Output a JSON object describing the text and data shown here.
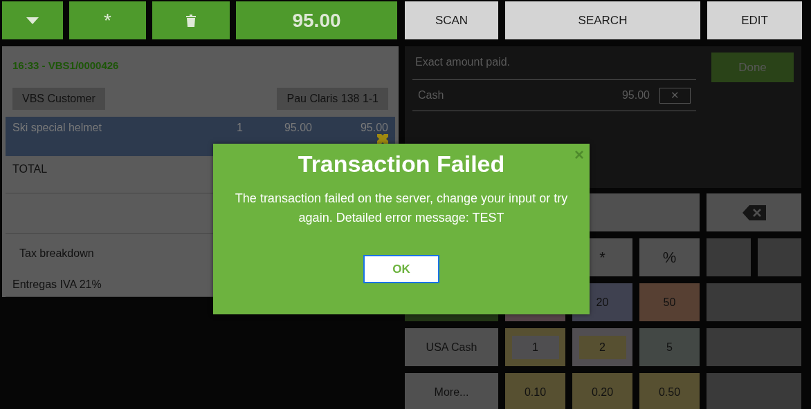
{
  "top_bar": {
    "left": [
      {
        "kind": "caret"
      },
      {
        "kind": "text",
        "label": "*"
      },
      {
        "kind": "trash"
      },
      {
        "kind": "total",
        "label": "95.00"
      }
    ],
    "right": [
      {
        "label": "SCAN"
      },
      {
        "label": "SEARCH"
      },
      {
        "label": "EDIT"
      }
    ]
  },
  "ticket": {
    "header": "16:33 - VBS1/0000426",
    "customer": "VBS Customer",
    "address": "Pau Claris 138 1-1",
    "lines": [
      {
        "name": "Ski special helmet",
        "qty": "1",
        "price": "95.00",
        "total": "95.00",
        "selected": true
      }
    ],
    "total_label": "TOTAL",
    "tax_title": "Tax breakdown",
    "tax_rows": [
      "Entregas IVA 21%"
    ]
  },
  "payment": {
    "message": "Exact amount paid.",
    "done": "Done",
    "payments": [
      {
        "method": "Cash",
        "amount": "95.00",
        "remove": "✕"
      }
    ]
  },
  "keypad": [
    {
      "kind": "display"
    },
    {
      "kind": "backspace"
    },
    {
      "kind": "key",
      "label": "*",
      "color": "#505050"
    },
    {
      "kind": "key",
      "label": "%",
      "color": "#505050"
    },
    {
      "kind": "split",
      "color": "#3a3a3a"
    },
    {
      "kind": "key",
      "color": "#223516"
    },
    {
      "kind": "key",
      "color": "#554448"
    },
    {
      "kind": "key",
      "label": "20",
      "color": "#3f4150"
    },
    {
      "kind": "key",
      "label": "50",
      "color": "#574033"
    },
    {
      "kind": "key",
      "color": "#3a3a3a"
    },
    {
      "kind": "key",
      "label": "USA Cash",
      "color": "#505050"
    },
    {
      "kind": "key",
      "label": "1",
      "color": "#575031",
      "chip": {
        "color": "#4f4e50"
      }
    },
    {
      "kind": "key",
      "label": "2",
      "color": "#514e52",
      "chip": {
        "color": "#575031"
      }
    },
    {
      "kind": "key",
      "label": "5",
      "color": "#434845"
    },
    {
      "kind": "key",
      "color": "#3a3a3a"
    },
    {
      "kind": "key",
      "label": "More...",
      "color": "#505050"
    },
    {
      "kind": "key",
      "label": "0.10",
      "color": "#575031"
    },
    {
      "kind": "key",
      "label": "0.20",
      "color": "#575031"
    },
    {
      "kind": "key",
      "label": "0.50",
      "color": "#575031"
    },
    {
      "kind": "key",
      "color": "#3a3a3a"
    }
  ],
  "dialog": {
    "title": "Transaction Failed",
    "close": "×",
    "message": "The transaction failed on the server, change your input or try again. Detailed error message: TEST",
    "ok": "OK"
  }
}
